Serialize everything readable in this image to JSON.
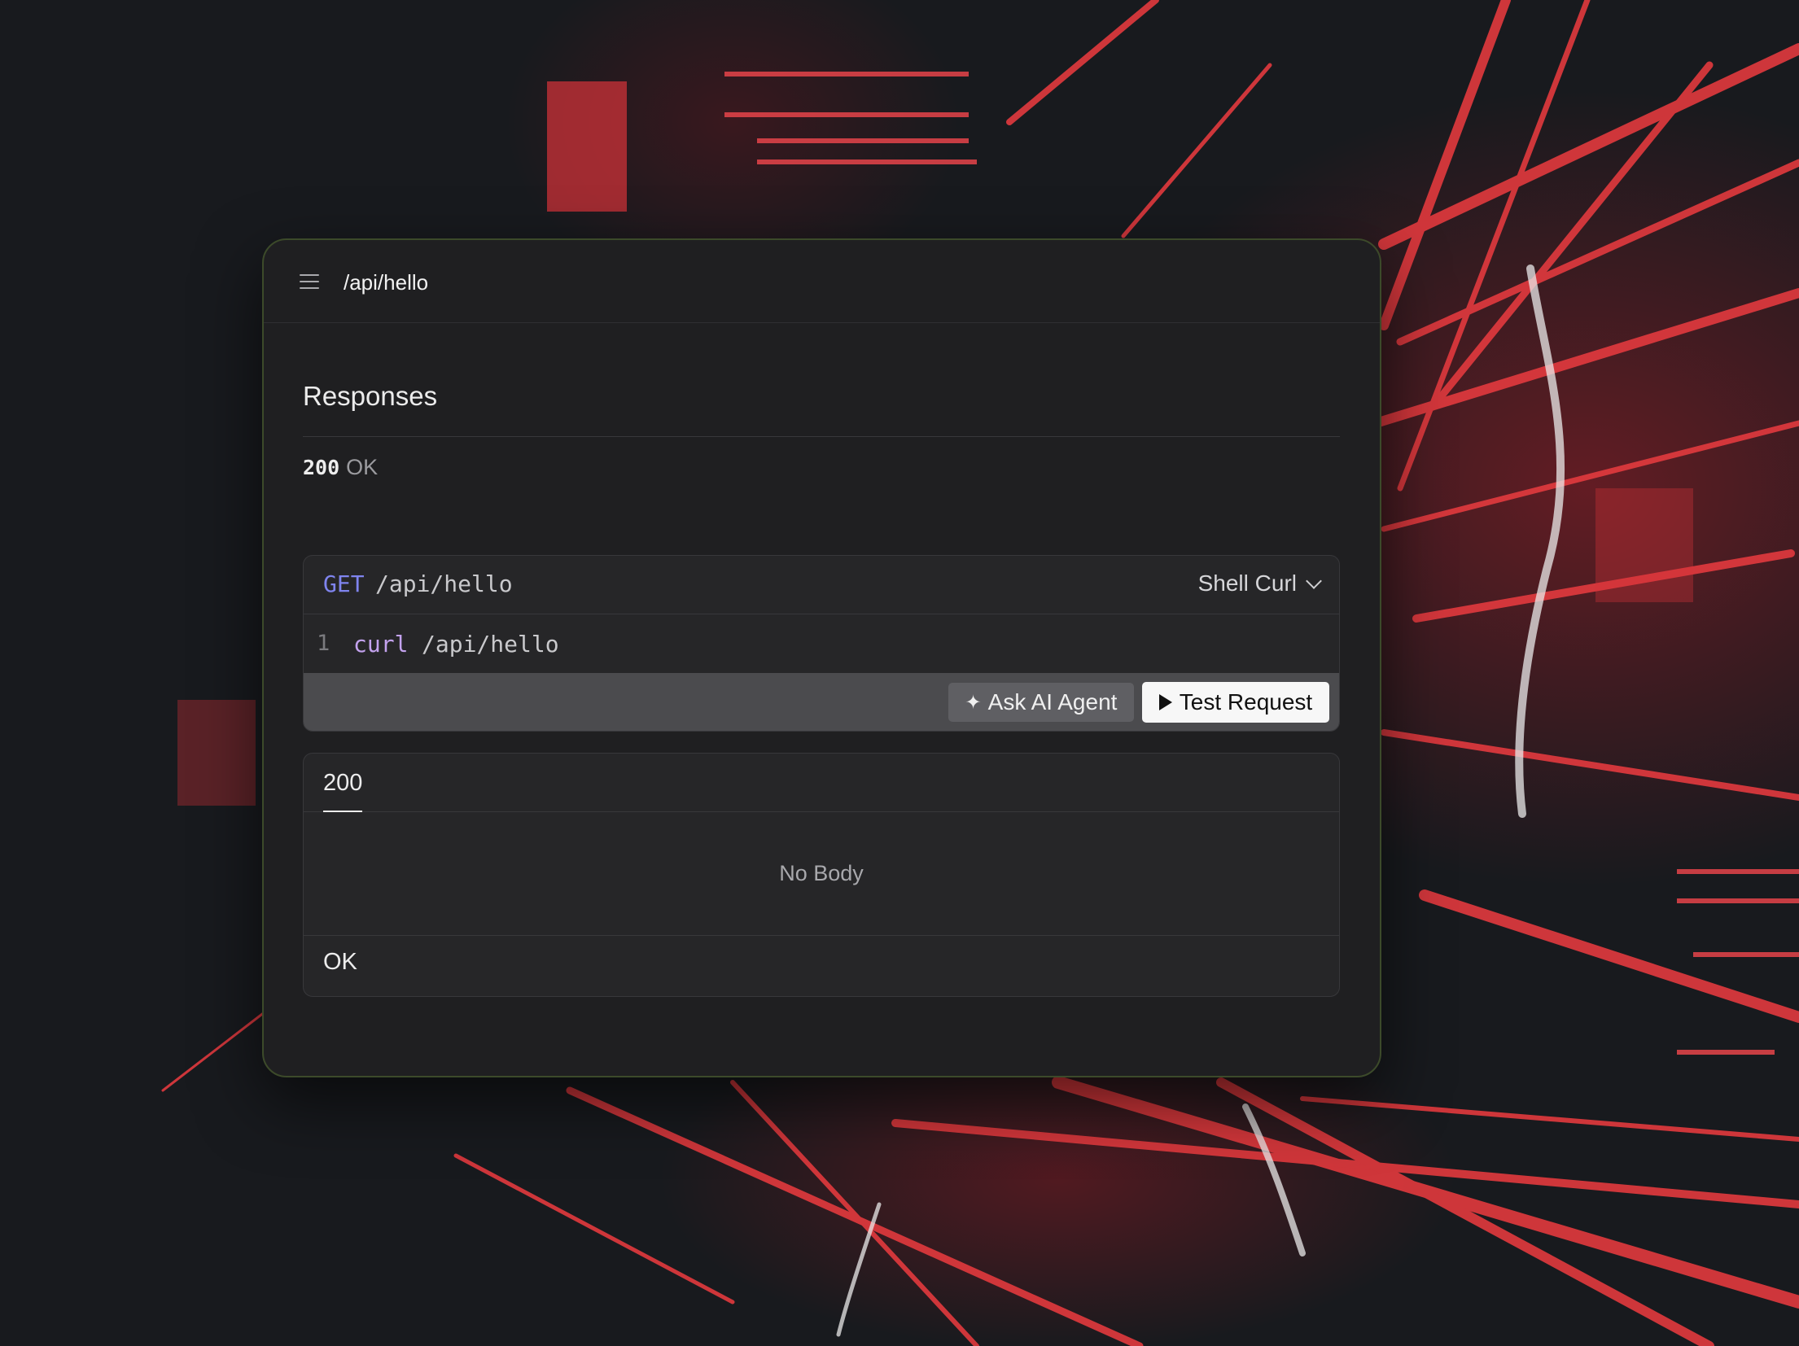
{
  "topbar": {
    "menu_icon": "hamburger-menu-icon",
    "title": "/api/hello"
  },
  "responses": {
    "heading": "Responses",
    "status_code": "200",
    "status_text": "OK"
  },
  "request": {
    "method": "GET",
    "path": "/api/hello",
    "language": "Shell Curl",
    "code_lines": [
      {
        "number": "1",
        "command": "curl",
        "argument": "/api/hello"
      }
    ],
    "ask_ai_label": "Ask AI Agent",
    "ask_ai_icon": "sparkle-icon",
    "test_label": "Test Request",
    "test_icon": "play-icon"
  },
  "response": {
    "tab_label": "200",
    "body_text": "No Body",
    "description": "OK"
  },
  "colors": {
    "method_get": "#7f84ee",
    "code_keyword": "#c3a2ee",
    "window_border": "#3c4a2a",
    "background_accent": "#e0383c"
  }
}
